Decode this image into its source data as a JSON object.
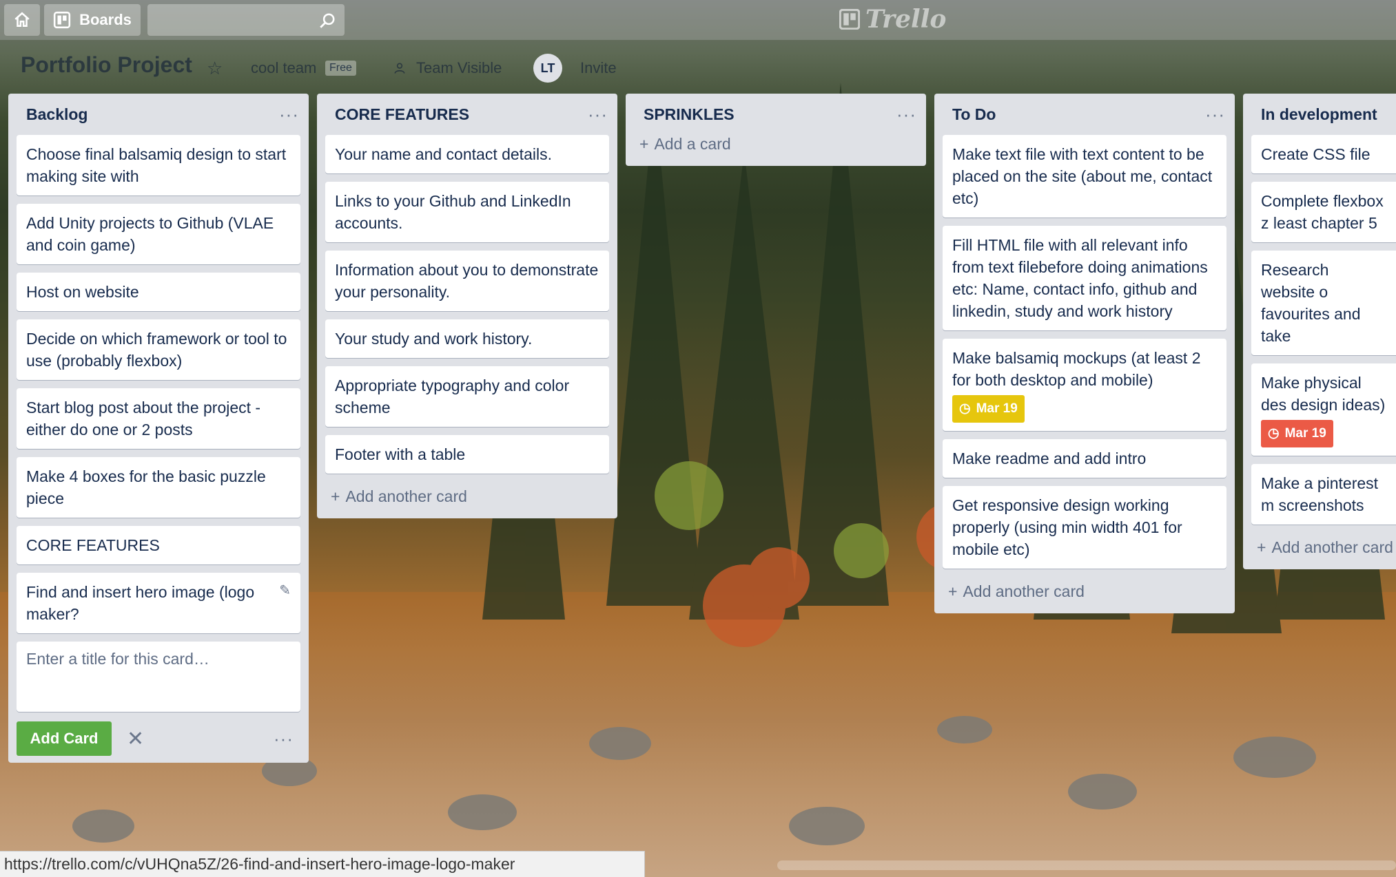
{
  "topbar": {
    "boards_label": "Boards",
    "logo_text": "Trello"
  },
  "board": {
    "title": "Portfolio Project",
    "team": "cool team",
    "plan_badge": "Free",
    "visibility": "Team Visible",
    "member_initials": "LT",
    "invite_label": "Invite"
  },
  "lists": [
    {
      "title": "Backlog",
      "cards": [
        "Choose final balsamiq design to start making site with",
        "Add Unity projects to Github (VLAE and coin game)",
        "Host on website",
        "Decide on which framework or tool to use (probably flexbox)",
        "Start blog post about the project - either do one or 2 posts",
        "Make 4 boxes for the basic puzzle piece",
        "CORE FEATURES",
        "Find and insert hero image (logo maker?"
      ],
      "composer_placeholder": "Enter a title for this card…",
      "add_button": "Add Card"
    },
    {
      "title": "CORE FEATURES",
      "cards": [
        "Your name and contact details.",
        "Links to your Github and LinkedIn accounts.",
        "Information about you to demonstrate your personality.",
        "Your study and work history.",
        "Appropriate typography and color scheme",
        "Footer with a table"
      ],
      "add_label": "Add another card"
    },
    {
      "title": "SPRINKLES",
      "cards": [],
      "add_label": "Add a card"
    },
    {
      "title": "To Do",
      "cards": [
        "Make text file with text content to be placed on the site (about me, contact etc)",
        "Fill HTML file with all relevant info from text filebefore doing animations etc: Name, contact info, github and linkedin, study and work history",
        "Make balsamiq mockups (at least 2 for both desktop and mobile)",
        "Make readme and add intro",
        "Get responsive design working properly (using min width 401 for mobile etc)"
      ],
      "due_label": "Mar 19",
      "add_label": "Add another card"
    },
    {
      "title": "In development",
      "cards": [
        "Create CSS file",
        "Complete flexbox z least chapter 5",
        "Research website o favourites and take",
        "Make physical des design ideas)",
        "Make a pinterest m screenshots"
      ],
      "due_label": "Mar 19",
      "add_label": "Add another card"
    }
  ],
  "status_bar": "https://trello.com/c/vUHQna5Z/26-find-and-insert-hero-image-logo-maker",
  "colors": {
    "due_soon": "#e6c60d",
    "overdue": "#eb5a46",
    "add_button": "#5aac44"
  },
  "icons": [
    "home-icon",
    "boards-icon",
    "search-icon",
    "star-icon",
    "team-visible-icon",
    "clock-icon",
    "pencil-icon",
    "close-icon",
    "plus-icon"
  ]
}
